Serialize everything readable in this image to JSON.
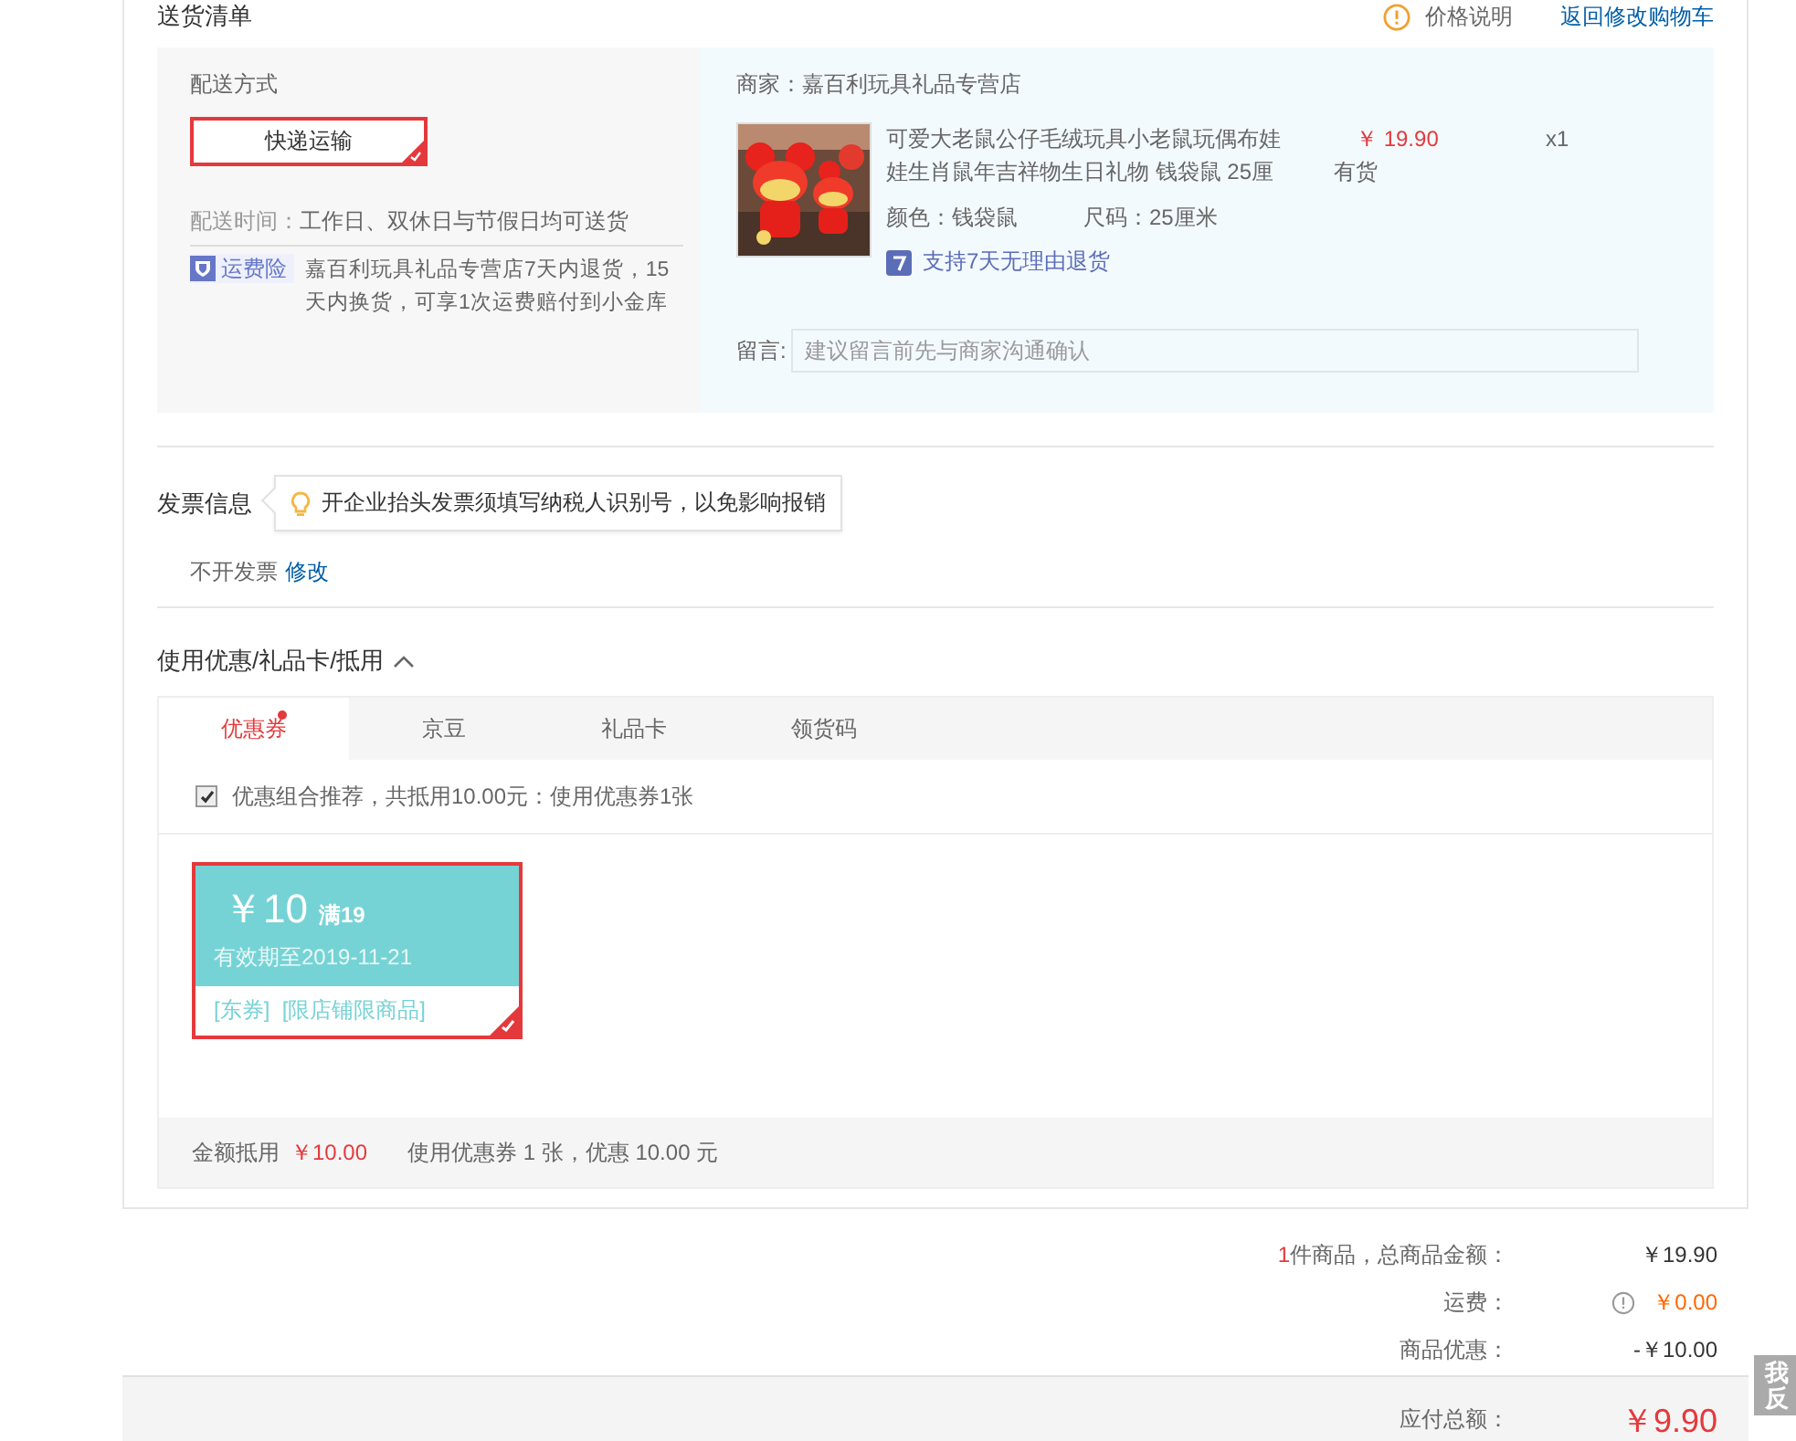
{
  "section_title": "送货清单",
  "price_note": "价格说明",
  "back_link": "返回修改购物车",
  "delivery": {
    "label": "配送方式",
    "method": "快递运输",
    "method_selected": true,
    "time_label": "配送时间：",
    "time_value": "工作日、双休日与节假日均可送货",
    "insurance_badge": "运费险",
    "insurance_text": "嘉百利玩具礼品专营店7天内退货，15天内换货，可享1次运费赔付到小金库"
  },
  "shop": {
    "label": "商家：嘉百利玩具礼品专营店",
    "item": {
      "kind": "picture",
      "title": "可爱大老鼠公仔毛绒玩具小老鼠玩偶布娃娃生肖鼠年吉祥物生日礼物 钱袋鼠 25厘",
      "price": "￥ 19.90",
      "stock": "有货",
      "qty": "x1",
      "color_option": "颜色：钱袋鼠",
      "size_option": "尺码：25厘米",
      "return_policy": "支持7天无理由退货"
    },
    "note_label": "留言:",
    "note_placeholder": "建议留言前先与商家沟通确认"
  },
  "invoice": {
    "title": "发票信息",
    "tip": "开企业抬头发票须填写纳税人识别号，以免影响报销",
    "value": "不开发票",
    "edit": "修改"
  },
  "discount": {
    "title": "使用优惠/礼品卡/抵用",
    "expanded": true,
    "tabs": [
      {
        "label": "优惠券",
        "selected": true,
        "dot": true
      },
      {
        "label": "京豆",
        "selected": false,
        "dot": false
      },
      {
        "label": "礼品卡",
        "selected": false,
        "dot": false
      },
      {
        "label": "领货码",
        "selected": false,
        "dot": false
      }
    ],
    "combo": {
      "checked": true,
      "text": "优惠组合推荐，共抵用10.00元：使用优惠券1张"
    },
    "coupons": [
      {
        "amount": "￥10",
        "condition": "满19",
        "validity": "有效期至2019-11-21",
        "tags": "[东券]  [限店铺限商品]",
        "selected": true
      }
    ],
    "summary_label": "金额抵用",
    "summary_amount": "￥10.00",
    "summary_text": "使用优惠券 1 张，优惠 10.00 元"
  },
  "totals": [
    {
      "count": "1",
      "label": "件商品，总商品金额：",
      "value": "￥19.90",
      "info": false,
      "highlight": false
    },
    {
      "label": "运费：",
      "value": "￥0.00",
      "info": true,
      "highlight": true
    },
    {
      "label": "商品优惠：",
      "value": "-￥10.00",
      "info": false,
      "highlight": false
    }
  ],
  "grand_total": {
    "label": "应付总额：",
    "value": "￥9.90"
  },
  "feedback": [
    "我",
    "反"
  ]
}
